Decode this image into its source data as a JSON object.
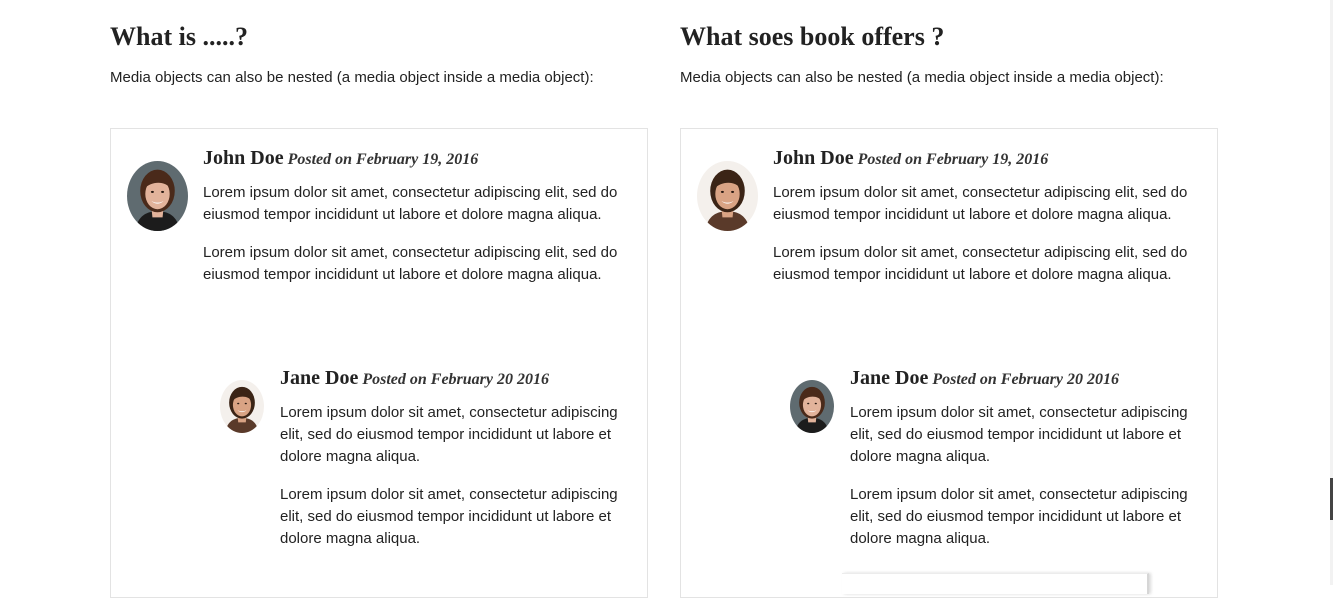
{
  "left": {
    "heading": "What is .....?",
    "intro": "Media objects can also be nested (a media object inside a media object):",
    "comment": {
      "name": "John Doe",
      "posted": "Posted on February 19, 2016",
      "paragraphs": [
        "Lorem ipsum dolor sit amet, consectetur adipiscing elit, sed do eiusmod tempor incididunt ut labore et dolore magna aliqua.",
        "Lorem ipsum dolor sit amet, consectetur adipiscing elit, sed do eiusmod tempor incididunt ut labore et dolore magna aliqua."
      ],
      "reply": {
        "name": "Jane Doe",
        "posted": "Posted on February 20 2016",
        "paragraphs": [
          "Lorem ipsum dolor sit amet, consectetur adipiscing elit, sed do eiusmod tempor incididunt ut labore et dolore magna aliqua.",
          "Lorem ipsum dolor sit amet, consectetur adipiscing elit, sed do eiusmod tempor incididunt ut labore et dolore magna aliqua."
        ]
      }
    }
  },
  "right": {
    "heading": "What soes book offers ?",
    "intro": "Media objects can also be nested (a media object inside a media object):",
    "comment": {
      "name": "John Doe",
      "posted": "Posted on February 19, 2016",
      "paragraphs": [
        "Lorem ipsum dolor sit amet, consectetur adipiscing elit, sed do eiusmod tempor incididunt ut labore et dolore magna aliqua.",
        "Lorem ipsum dolor sit amet, consectetur adipiscing elit, sed do eiusmod tempor incididunt ut labore et dolore magna aliqua."
      ],
      "reply": {
        "name": "Jane Doe",
        "posted": "Posted on February 20 2016",
        "paragraphs": [
          "Lorem ipsum dolor sit amet, consectetur adipiscing elit, sed do eiusmod tempor incididunt ut labore et dolore magna aliqua.",
          "Lorem ipsum dolor sit amet, consectetur adipiscing elit, sed do eiusmod tempor incididunt ut labore et dolore magna aliqua."
        ]
      }
    }
  },
  "avatars": {
    "woman_grey_bg": {
      "icon": "avatar-woman-grey-background-icon",
      "background": "#5f6b70",
      "hair": "#4a2a1a",
      "skin": "#e2b39b",
      "clothing": "#1c1c1c"
    },
    "woman_white_bg": {
      "icon": "avatar-woman-white-background-icon",
      "background": "#f4f0ec",
      "hair": "#3b2416",
      "skin": "#d9a384",
      "clothing": "#5a3a2a"
    }
  }
}
